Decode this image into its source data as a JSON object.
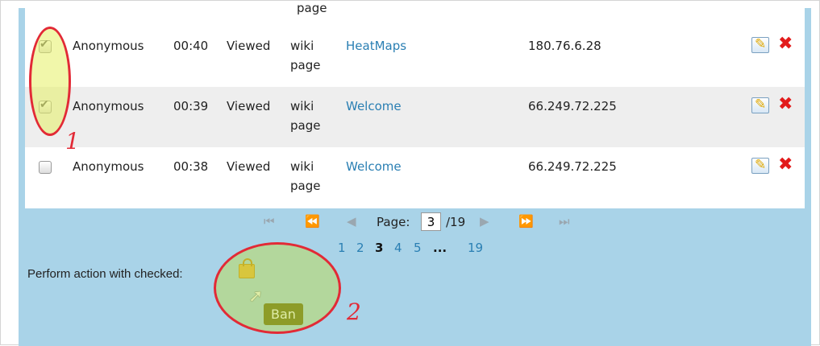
{
  "partial_row_text": "page",
  "rows": [
    {
      "checked": true,
      "user": "Anonymous",
      "time": "00:40",
      "action": "Viewed",
      "object": "wiki page",
      "page": "HeatMaps",
      "ip": "180.76.6.28"
    },
    {
      "checked": true,
      "user": "Anonymous",
      "time": "00:39",
      "action": "Viewed",
      "object": "wiki page",
      "page": "Welcome",
      "ip": "66.249.72.225"
    },
    {
      "checked": false,
      "user": "Anonymous",
      "time": "00:38",
      "action": "Viewed",
      "object": "wiki page",
      "page": "Welcome",
      "ip": "66.249.72.225"
    }
  ],
  "pager": {
    "label": "Page:",
    "current": "3",
    "total": "/19",
    "pages": [
      "1",
      "2",
      "3",
      "4",
      "5",
      "...",
      "19"
    ]
  },
  "bulk_action": {
    "label": "Perform action with checked:",
    "tooltip": "Ban"
  },
  "annotations": [
    "1",
    "2"
  ],
  "icons": {
    "edit": "edit-icon",
    "delete": "delete-icon",
    "lock": "lock-icon",
    "first": "first-page-icon",
    "prev_fast": "fast-back-icon",
    "prev": "prev-page-icon",
    "next": "next-page-icon",
    "next_fast": "fast-forward-icon",
    "last": "last-page-icon",
    "cursor": "cursor-icon"
  },
  "colors": {
    "link": "#2a7fb3",
    "panel": "#a9d3e8",
    "annotation": "#e22a36",
    "delete": "#e21b1b"
  }
}
